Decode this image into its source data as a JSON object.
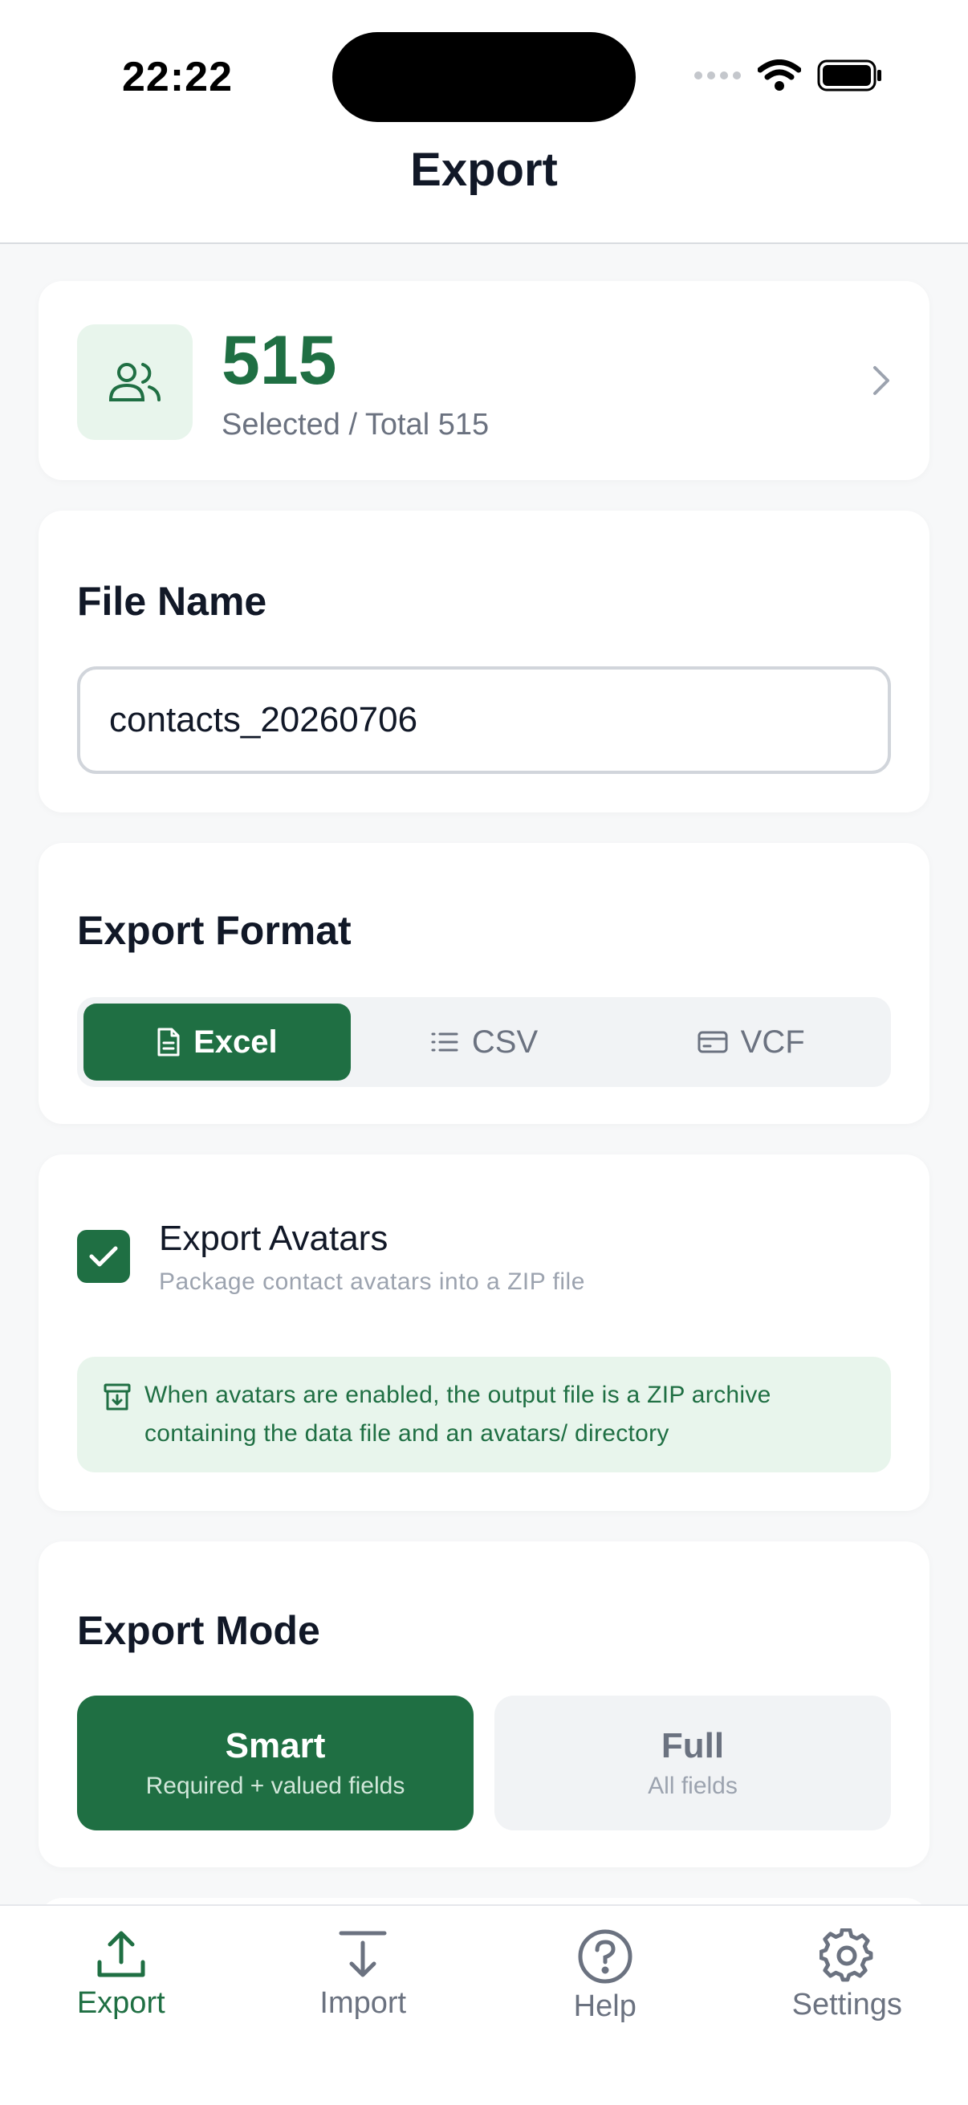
{
  "status": {
    "time": "22:22"
  },
  "header": {
    "title": "Export"
  },
  "summary": {
    "count": "515",
    "subtitle": "Selected / Total 515"
  },
  "file_name": {
    "title": "File Name",
    "value": "contacts_20260706"
  },
  "format": {
    "title": "Export Format",
    "options": [
      {
        "label": "Excel",
        "icon": "file-icon",
        "selected": true
      },
      {
        "label": "CSV",
        "icon": "list-icon",
        "selected": false
      },
      {
        "label": "VCF",
        "icon": "card-icon",
        "selected": false
      }
    ]
  },
  "avatars": {
    "checked": true,
    "title": "Export Avatars",
    "subtitle": "Package contact avatars into a ZIP file",
    "info": "When avatars are enabled, the output file is a ZIP archive containing the data file and an avatars/ directory"
  },
  "mode": {
    "title": "Export Mode",
    "options": [
      {
        "label": "Smart",
        "desc": "Required + valued fields",
        "selected": true
      },
      {
        "label": "Full",
        "desc": "All fields",
        "selected": false
      }
    ]
  },
  "tabs": [
    {
      "label": "Export",
      "icon": "upload-icon",
      "active": true
    },
    {
      "label": "Import",
      "icon": "download-icon",
      "active": false
    },
    {
      "label": "Help",
      "icon": "help-icon",
      "active": false
    },
    {
      "label": "Settings",
      "icon": "gear-icon",
      "active": false
    }
  ],
  "colors": {
    "accent": "#1f6f43",
    "accent_light": "#e8f5ec",
    "muted": "#6b7280"
  }
}
